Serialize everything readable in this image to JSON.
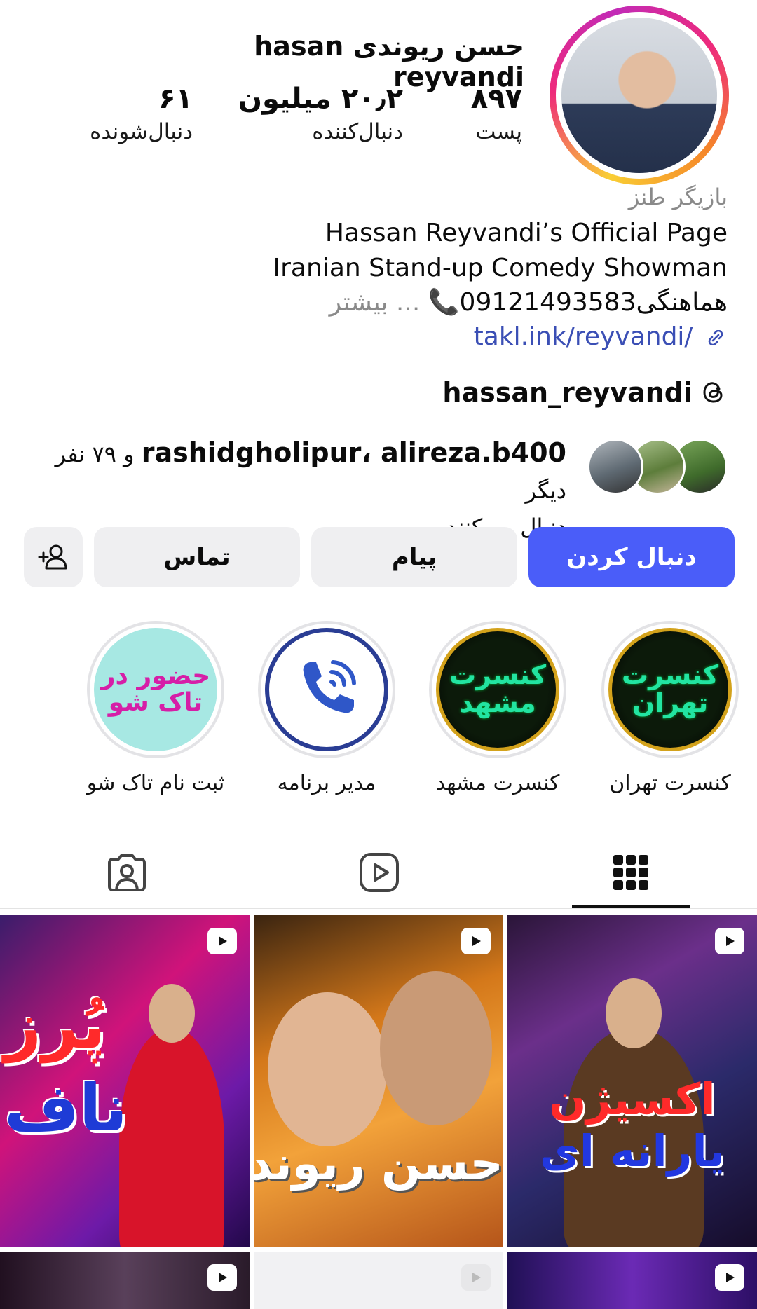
{
  "profile": {
    "display_name": "حسن ریوندی hasan reyvandi",
    "stats": {
      "posts_count": "۸۹۷",
      "posts_label": "پست",
      "followers_count": "۲۰٫۲ میلیون",
      "followers_label": "دنبال‌کننده",
      "following_count": "۶۱",
      "following_label": "دنبال‌شونده"
    }
  },
  "bio": {
    "category": "بازیگر طنز",
    "line1": "Hassan Reyvandi’s Official Page",
    "line2": "Iranian Stand-up Comedy Showman",
    "line3_text": "هماهنگی09121493583📞",
    "line3_more": "... بیشتر",
    "link": "takl.ink/reyvandi/"
  },
  "threads": {
    "username": "hassan_reyvandi",
    "icon": "threads-icon"
  },
  "mutual": {
    "names": "rashidgholipur، alireza.b400",
    "suffix": " و ۷۹ نفر دیگر",
    "line2": "دنبال می‌کنند"
  },
  "actions": {
    "follow": "دنبال کردن",
    "message": "پیام",
    "contact": "تماس",
    "add_user_icon": "add-person-icon"
  },
  "highlights": [
    {
      "label": "کنسرت تهران",
      "cover_line1": "کنسرت",
      "cover_line2": "تهران"
    },
    {
      "label": "کنسرت مشهد",
      "cover_line1": "کنسرت",
      "cover_line2": "مشهد"
    },
    {
      "label": "مدیر برنامه",
      "cover_icon": "phone-icon"
    },
    {
      "label": "ثبت نام تاک شو",
      "cover_line1": "حضور در",
      "cover_line2": "تاک شو"
    }
  ],
  "tabs": [
    {
      "icon": "grid-icon",
      "selected": true
    },
    {
      "icon": "reels-icon",
      "selected": false
    },
    {
      "icon": "tagged-icon",
      "selected": false
    }
  ],
  "posts": [
    {
      "type": "reel",
      "overlay_line1": "پُرز",
      "overlay_line2": "ناف"
    },
    {
      "type": "reel",
      "overlay_line1": "حسن ریوندی"
    },
    {
      "type": "reel",
      "overlay_line1": "اکسیژن",
      "overlay_line2": "یارانه ای"
    },
    {
      "type": "reel"
    },
    {
      "type": "reel"
    },
    {
      "type": "reel"
    }
  ],
  "colors": {
    "follow_button": "#4a5df9",
    "secondary_button": "#efeff1",
    "link": "#3b4fb5",
    "muted_text": "#8a8a8a"
  }
}
